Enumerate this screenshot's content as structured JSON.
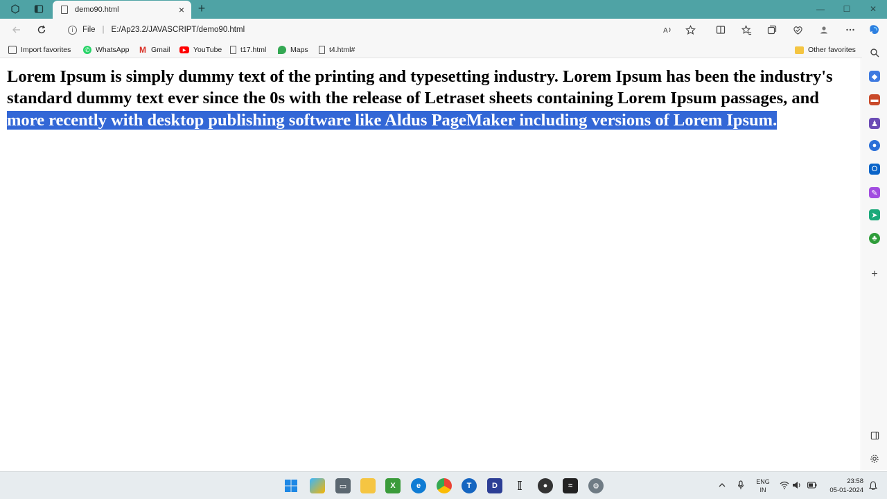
{
  "window": {
    "tab_title": "demo90.html",
    "tab_close": "×",
    "new_tab": "+",
    "minimize": "—",
    "maximize": "☐",
    "close": "✕"
  },
  "address_bar": {
    "scheme_label": "File",
    "separator": "|",
    "url": "E:/Ap23.2/JAVASCRIPT/demo90.html"
  },
  "favorites": [
    {
      "label": "Import favorites",
      "icon": "import-icon"
    },
    {
      "label": "WhatsApp",
      "icon": "whatsapp-icon"
    },
    {
      "label": "Gmail",
      "icon": "gmail-icon"
    },
    {
      "label": "YouTube",
      "icon": "youtube-icon"
    },
    {
      "label": "t17.html",
      "icon": "page-icon"
    },
    {
      "label": "Maps",
      "icon": "maps-icon"
    },
    {
      "label": "t4.html#",
      "icon": "page-icon"
    }
  ],
  "other_favorites": "Other favorites",
  "content": {
    "text_unselected": "Lorem Ipsum is simply dummy text of the printing and typesetting industry. Lorem Ipsum has been the industry's standard dummy text ever since the 0s with the release of Letraset sheets containing Lorem Ipsum passages, and",
    "text_selected": "more recently with desktop publishing software like Aldus PageMaker including versions of Lorem Ipsum."
  },
  "system_tray": {
    "lang_line1": "ENG",
    "lang_line2": "IN",
    "time": "23:58",
    "date": "05-01-2024"
  },
  "colors": {
    "titlebar": "#4fa3a5",
    "selection": "#3367d6"
  }
}
